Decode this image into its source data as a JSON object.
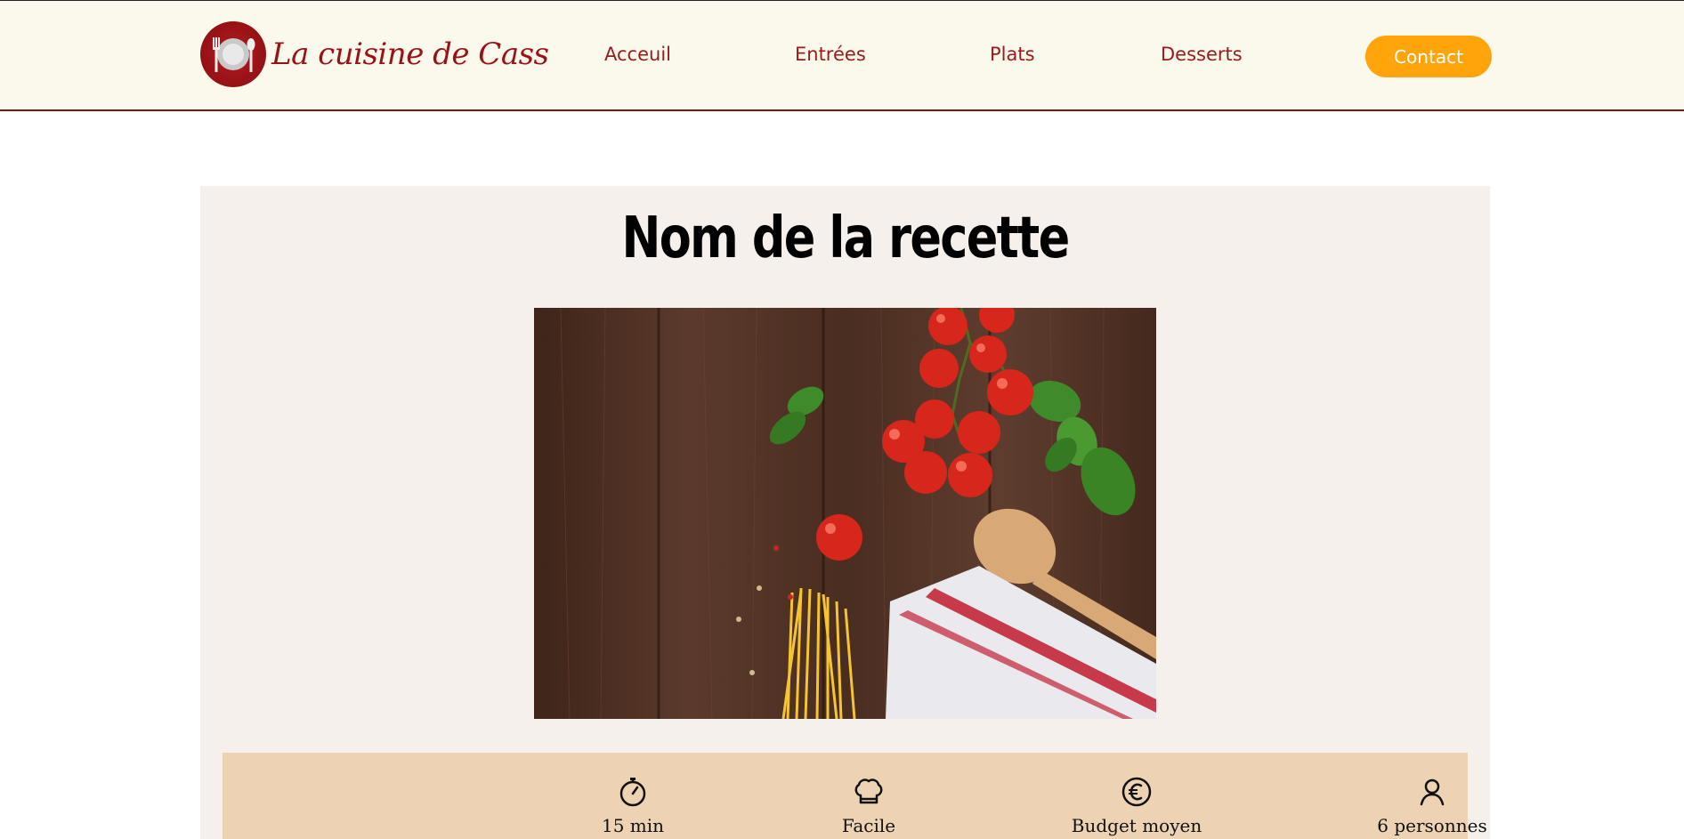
{
  "brand": {
    "name": "La cuisine de Cass"
  },
  "nav": {
    "items": [
      "Acceuil",
      "Entrées",
      "Plats",
      "Desserts"
    ],
    "contact": "Contact"
  },
  "recipe": {
    "title": "Nom de la recette",
    "image_icon": "food-photo-icon",
    "info": [
      {
        "icon": "stopwatch-icon",
        "label": "15 min"
      },
      {
        "icon": "chef-hat-icon",
        "label": "Facile"
      },
      {
        "icon": "euro-icon",
        "label": "Budget moyen"
      },
      {
        "icon": "person-icon",
        "label": "6 personnes"
      }
    ]
  },
  "colors": {
    "header_bg": "#fbf9ec",
    "brand_red": "#9a1216",
    "contact_orange": "#ffa40a",
    "card_bg": "#f5f0eb",
    "info_bg": "#edd3b3"
  }
}
